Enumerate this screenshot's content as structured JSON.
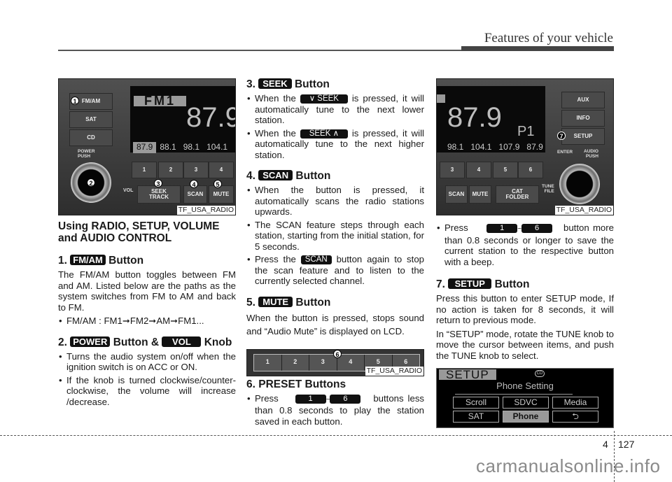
{
  "header": {
    "section_title": "Features of your vehicle"
  },
  "col1": {
    "figure": {
      "caption": "TF_USA_RADIO",
      "lcd_band": "FM1",
      "lcd_freq": "87.9",
      "lcd_presets": [
        "87.9",
        "88.1",
        "98.1",
        "104.1"
      ],
      "buttons": {
        "fmam": "FM/AM",
        "sat": "SAT",
        "cd": "CD",
        "power": "POWER",
        "push": "PUSH",
        "vol": "VOL",
        "seek": "SEEK",
        "track": "TRACK",
        "scan": "SCAN",
        "mute": "MUTE"
      },
      "preset_keys": [
        "1",
        "2",
        "3",
        "4"
      ],
      "callouts": [
        "1",
        "2",
        "3",
        "4",
        "5"
      ]
    },
    "heading": "Using RADIO, SETUP, VOLUME and AUDIO CONTROL",
    "s1": {
      "num": "1.",
      "badge": "FM/AM",
      "suffix": "Button",
      "body": "The FM/AM button toggles between FM and AM. Listed below are the paths as the system switches from FM to AM and back to FM.",
      "path": "FM/AM : FM1➞FM2➞AM➞FM1..."
    },
    "s2": {
      "num": "2.",
      "badge1": "POWER",
      "mid": "Button &",
      "badge2": "VOL",
      "suffix": "Knob",
      "bullets": [
        "Turns the audio system on/off when the ignition switch is on ACC or ON.",
        "If the knob is turned clockwise/counter-clockwise, the volume will increase /decrease."
      ]
    }
  },
  "col2": {
    "s3": {
      "num": "3.",
      "badge": "SEEK",
      "suffix": "Button",
      "b1_pre": "When the",
      "b1_badge": "∨ SEEK",
      "b1_post": "is pressed, it will automatically tune to the next lower station.",
      "b2_pre": "When the",
      "b2_badge": "SEEK ∧",
      "b2_post": "is pressed, it will automatically tune to the next higher station."
    },
    "s4": {
      "num": "4.",
      "badge": "SCAN",
      "suffix": "Button",
      "b1": "When the button is pressed, it automatically scans the radio stations upwards.",
      "b2": "The SCAN feature steps through each station, starting from the initial station, for 5 seconds.",
      "b3_pre": "Press the",
      "b3_badge": "SCAN",
      "b3_post": "button again to stop the scan feature and to listen to the currently selected channel."
    },
    "s5": {
      "num": "5.",
      "badge": "MUTE",
      "suffix": "Button",
      "body": "When the button is pressed, stops sound and “Audio Mute” is displayed on LCD."
    },
    "figure": {
      "caption": "TF_USA_RADIO",
      "keys": [
        "1",
        "2",
        "3",
        "4",
        "5",
        "6"
      ],
      "callout": "6"
    },
    "s6": {
      "heading": "6. PRESET Buttons",
      "b1_pre": "Press",
      "badge_a": "1",
      "tilde": "~",
      "badge_b": "6",
      "b1_post": "buttons less than 0.8 seconds to play the station saved in each button."
    }
  },
  "col3": {
    "figure": {
      "caption": "TF_USA_RADIO",
      "lcd_freq": "87.9",
      "lcd_preset_tag": "P1",
      "lcd_presets": [
        "98.1",
        "104.1",
        "107.9",
        "87.9"
      ],
      "buttons": {
        "aux": "AUX",
        "info": "INFO",
        "setup": "SETUP",
        "enter": "ENTER",
        "audio": "AUDIO",
        "push": "PUSH",
        "tune": "TUNE",
        "file": "FILE",
        "scan": "SCAN",
        "mute": "MUTE",
        "cat": "CAT",
        "folder": "FOLDER"
      },
      "preset_keys": [
        "3",
        "4",
        "5",
        "6"
      ],
      "callout": "7"
    },
    "preset_save": {
      "pre": "Press",
      "badge_a": "1",
      "tilde": "~",
      "badge_b": "6",
      "post": "button more than 0.8 seconds or longer to save the current station to the respective button with a beep."
    },
    "s7": {
      "num": "7.",
      "badge": "SETUP",
      "suffix": "Button",
      "p1": "Press this button to enter SETUP mode, If no action is taken for 8 seconds, it will return to previous mode.",
      "p2": "In “SETUP” mode, rotate the TUNE knob to move the cursor between items, and push the TUNE knob to select."
    },
    "setup_screen": {
      "tag": "SETUP",
      "cd_icon": "CD",
      "heading": "Phone Setting",
      "items": [
        "Scroll",
        "SDVC",
        "Media",
        "SAT",
        "Phone",
        "⮌"
      ],
      "selected": "Phone"
    }
  },
  "footer": {
    "chapter": "4",
    "page": "127",
    "watermark": "carmanualsonline.info"
  }
}
